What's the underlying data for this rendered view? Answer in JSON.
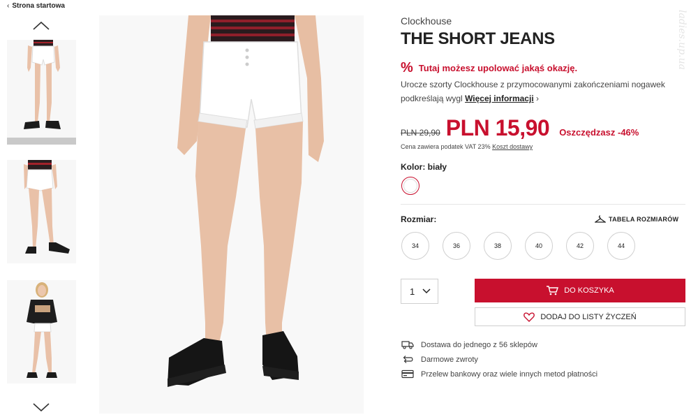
{
  "breadcrumb": {
    "label": "Strona startowa"
  },
  "gallery": {
    "thumbnails": [
      {
        "name": "front-view",
        "active": true
      },
      {
        "name": "back-view",
        "active": false
      },
      {
        "name": "model-view",
        "active": false
      }
    ]
  },
  "product": {
    "brand": "Clockhouse",
    "title": "THE SHORT JEANS",
    "promo": {
      "icon": "percent-icon",
      "text": "Tutaj możesz upolować jakąś okazję."
    },
    "description": "Urocze szorty Clockhouse z przymocowanymi zakończeniami nogawek podkreślają wygl",
    "more_link": "Więcej informacji",
    "old_price": "PLN 29,90",
    "new_price": "PLN 15,90",
    "savings": "Oszczędzasz -46%",
    "vat_note": "Cena zawiera podatek VAT 23%",
    "shipping_link": "Koszt dostawy",
    "color_label": "Kolor: biały",
    "selected_color": "#ffffff",
    "size_label": "Rozmiar:",
    "size_chart": "TABELA ROZMIARÓW",
    "sizes": [
      "34",
      "36",
      "38",
      "40",
      "42",
      "44"
    ],
    "quantity": "1",
    "add_to_cart": "DO KOSZYKA",
    "add_to_wishlist": "DODAJ DO LISTY ŻYCZEŃ",
    "features": [
      {
        "icon": "truck-icon",
        "text": "Dostawa do jednego z 56 sklepów"
      },
      {
        "icon": "return-icon",
        "text": "Darmowe zwroty"
      },
      {
        "icon": "card-icon",
        "text": "Przelew bankowy oraz wiele innych metod płatności"
      }
    ]
  },
  "watermark": "ladies.up.ua",
  "colors": {
    "accent": "#c8102e",
    "text": "#333333",
    "border": "#cfcfcf"
  }
}
